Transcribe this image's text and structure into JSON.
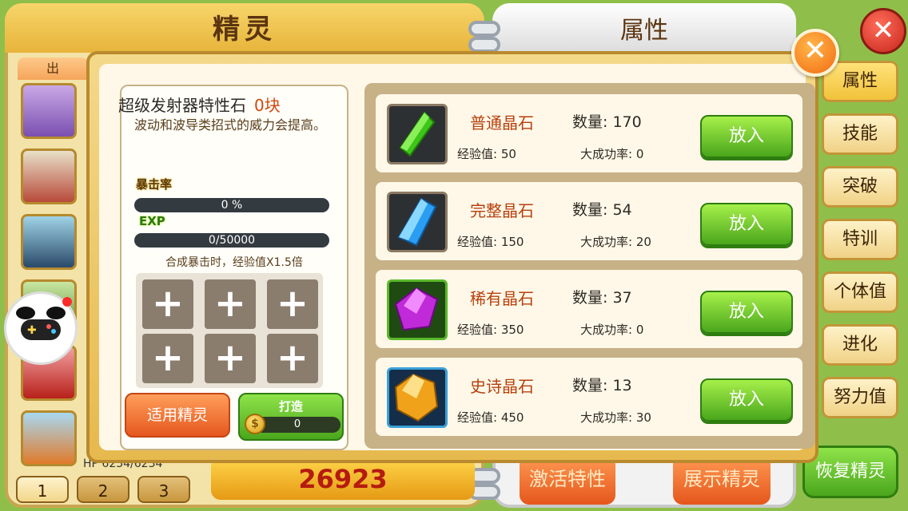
{
  "background": {
    "left_title": "精灵",
    "right_title": "属性",
    "left_subtab": "出",
    "hp_label": "HP 6234/6234",
    "power_value": "26923",
    "page_tabs": [
      "1",
      "2",
      "3"
    ],
    "side_tabs": [
      "属性",
      "技能",
      "突破",
      "特训",
      "个体值",
      "进化",
      "努力值"
    ],
    "activate_label": "激活特性",
    "show_label": "展示精灵",
    "restore_label": "恢复精灵"
  },
  "stone": {
    "title": "超级发射器特性石",
    "count": "0块",
    "description": "波动和波导类招式的威力会提高。",
    "crit_label": "暴击率",
    "crit_value": "0 %",
    "crit_fraction": 0,
    "exp_label": "EXP",
    "exp_value": "0/50000",
    "exp_fraction": 0,
    "craft_note": "合成暴击时，经验值X1.5倍",
    "apply_label": "适用精灵",
    "forge_label": "打造",
    "forge_cost": "0"
  },
  "crystals": [
    {
      "name": "普通晶石",
      "qty_label": "数量: 170",
      "exp_label": "经验值: 50",
      "rate_label": "大成功率: 0",
      "put_label": "放入",
      "icon": "green-crystal-icon",
      "color": "#3ec51a"
    },
    {
      "name": "完整晶石",
      "qty_label": "数量: 54",
      "exp_label": "经验值: 150",
      "rate_label": "大成功率: 20",
      "put_label": "放入",
      "icon": "blue-crystal-icon",
      "color": "#2a9ef2"
    },
    {
      "name": "稀有晶石",
      "qty_label": "数量: 37",
      "exp_label": "经验值: 350",
      "rate_label": "大成功率: 0",
      "put_label": "放入",
      "icon": "purple-crystal-icon",
      "color": "#c02ad8"
    },
    {
      "name": "史诗晶石",
      "qty_label": "数量: 13",
      "exp_label": "经验值: 450",
      "rate_label": "大成功率: 30",
      "put_label": "放入",
      "icon": "gold-crystal-icon",
      "color": "#f0a21a"
    }
  ],
  "colors": {
    "accent_orange": "#f26b12",
    "button_green": "#4aa61c",
    "name_red": "#b6400e"
  }
}
